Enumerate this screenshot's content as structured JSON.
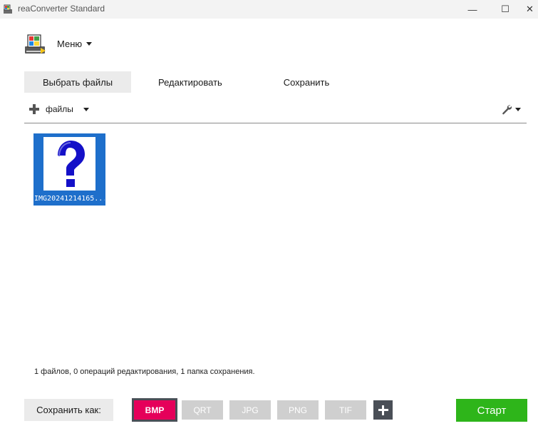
{
  "window": {
    "title": "reaConverter Standard",
    "controls": {
      "minimize": "—",
      "maximize": "☐",
      "close": "✕"
    }
  },
  "header": {
    "menu_label": "Меню"
  },
  "tabs": [
    {
      "label": "Выбрать файлы",
      "active": true
    },
    {
      "label": "Редактировать",
      "active": false
    },
    {
      "label": "Сохранить",
      "active": false
    }
  ],
  "toolbar": {
    "add_label": "файлы",
    "add_icon": "plus-icon",
    "settings_icon": "wrench-icon"
  },
  "files": [
    {
      "name": "IMG20241214165...",
      "selected": true,
      "thumb_icon": "question-mark-icon"
    }
  ],
  "status": "1 файлов, 0 операций редактирования, 1 папка сохранения.",
  "footer": {
    "save_as_label": "Сохранить как:",
    "formats": [
      {
        "label": "BMP",
        "active": true
      },
      {
        "label": "QRT",
        "active": false
      },
      {
        "label": "JPG",
        "active": false
      },
      {
        "label": "PNG",
        "active": false
      },
      {
        "label": "TIF",
        "active": false
      }
    ],
    "add_format_icon": "plus-icon",
    "start_label": "Старт"
  },
  "colors": {
    "accent_format": "#e5005a",
    "start_button": "#2eb51a",
    "selection": "#1e6fcb",
    "inactive_format": "#cfcfcf"
  }
}
